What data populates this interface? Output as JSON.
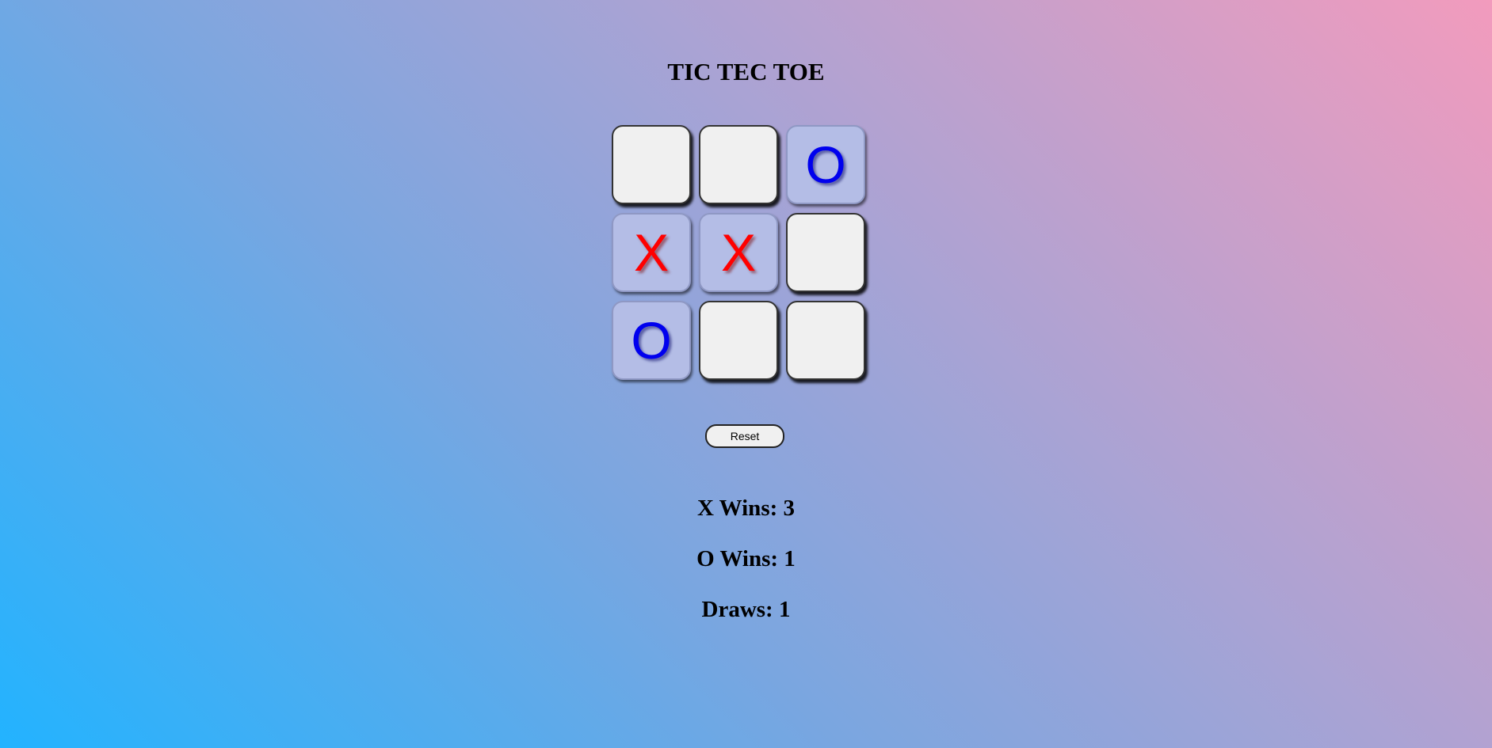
{
  "title": "TIC TEC TOE",
  "board": [
    {
      "mark": "",
      "state": "empty"
    },
    {
      "mark": "",
      "state": "empty"
    },
    {
      "mark": "O",
      "state": "filled"
    },
    {
      "mark": "X",
      "state": "filled"
    },
    {
      "mark": "X",
      "state": "filled"
    },
    {
      "mark": "",
      "state": "empty"
    },
    {
      "mark": "O",
      "state": "filled"
    },
    {
      "mark": "",
      "state": "empty"
    },
    {
      "mark": "",
      "state": "empty"
    }
  ],
  "reset_label": "Reset",
  "scores": {
    "x_wins": "X Wins: 3",
    "o_wins": "O Wins: 1",
    "draws": "Draws: 1"
  },
  "colors": {
    "x_mark": "#ff0000",
    "o_mark": "#0000ee",
    "cell_empty": "#f0f0f0",
    "cell_filled": "#b4bde6"
  }
}
